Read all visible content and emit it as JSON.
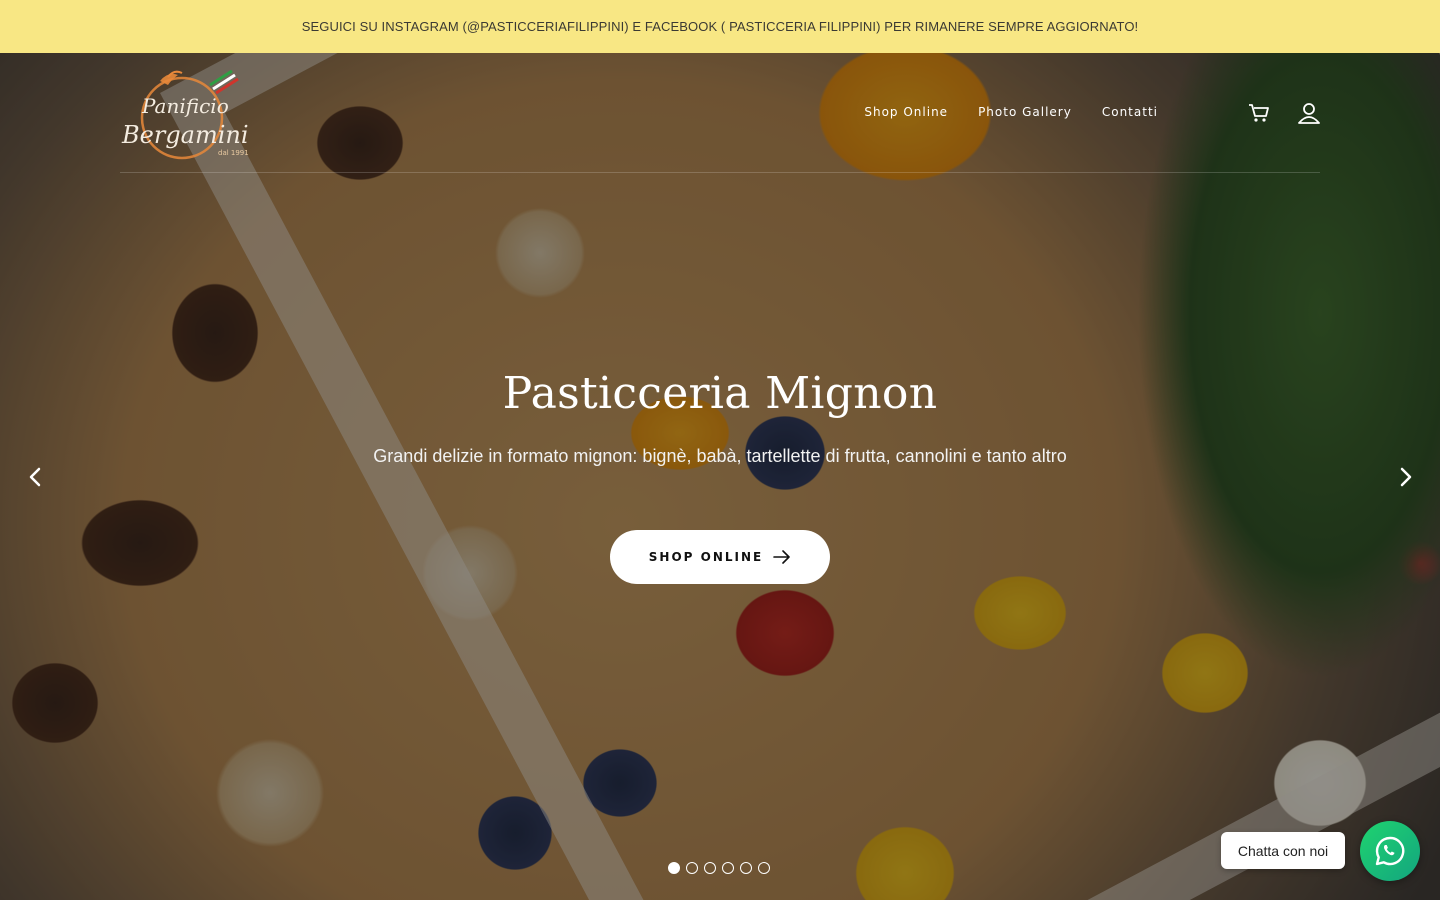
{
  "announcement": {
    "text": "SEGUICI SU INSTAGRAM (@PASTICCERIAFILIPPINI) E FACEBOOK ( PASTICCERIA FILIPPINI) PER RIMANERE SEMPRE AGGIORNATO!"
  },
  "logo": {
    "line1": "Panificio",
    "line2": "Bergamini",
    "since": "dal 1991"
  },
  "nav": {
    "items": [
      {
        "label": "Shop Online"
      },
      {
        "label": "Photo Gallery"
      },
      {
        "label": "Contatti"
      }
    ],
    "cart_icon": "cart-icon",
    "account_icon": "user-icon"
  },
  "hero": {
    "title": "Pasticceria Mignon",
    "subtitle": "Grandi delizie in formato mignon: bignè, babà, tartellette di frutta, cannolini e tanto altro",
    "cta_label": "SHOP ONLINE",
    "slides_total": 6,
    "active_slide": 1
  },
  "chat": {
    "bubble_label": "Chatta con noi",
    "icon": "whatsapp-icon"
  },
  "colors": {
    "announcement_bg": "#f8e784",
    "logo_orange": "#e8883a",
    "whatsapp_green": "#1fd36f"
  }
}
